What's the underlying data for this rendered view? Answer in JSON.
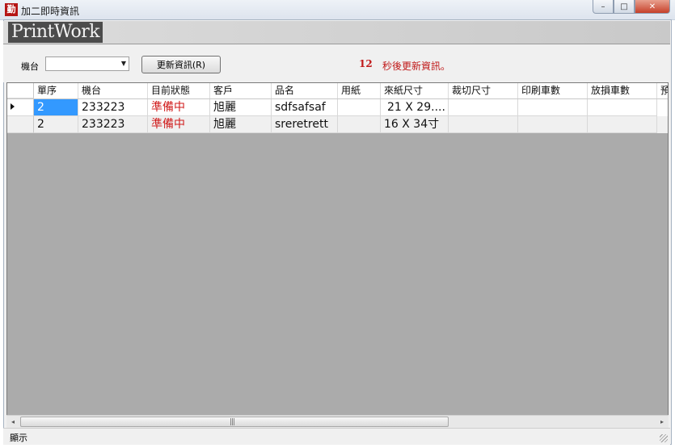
{
  "window": {
    "title": "加二即時資訊",
    "icon_glyph": "勤",
    "icon_name": "app-icon",
    "controls": {
      "minimize": "–",
      "maximize": "□",
      "close": "✕"
    }
  },
  "logo": {
    "text": "PrintWork"
  },
  "toolbar": {
    "machine_label": "機台",
    "machine_value": "",
    "refresh_label": "更新資訊(R)",
    "countdown_value": "12",
    "countdown_text": "秒後更新資訊。"
  },
  "grid": {
    "columns": [
      "單序",
      "機台",
      "目前狀態",
      "客戶",
      "品名",
      "用紙",
      "來紙尺寸",
      "裁切尺寸",
      "印刷車數",
      "放損車數",
      "預"
    ],
    "rows": [
      [
        "2",
        "233223",
        "準備中",
        "旭麗",
        "sdfsafsaf",
        "",
        "21 X 29....",
        "",
        "",
        "",
        ""
      ],
      [
        "2",
        "233223",
        "準備中",
        "旭麗",
        "sreretrett",
        "",
        "16 X 34寸",
        "",
        "",
        "",
        ""
      ]
    ],
    "selected_row": 0
  },
  "scrollbar": {
    "left": "◂",
    "right": "▸",
    "grip": "|||"
  },
  "status": {
    "text": "顯示"
  },
  "colors": {
    "accent_red": "#c01818",
    "selection": "#3399ff",
    "grid_bg": "#ababab"
  }
}
